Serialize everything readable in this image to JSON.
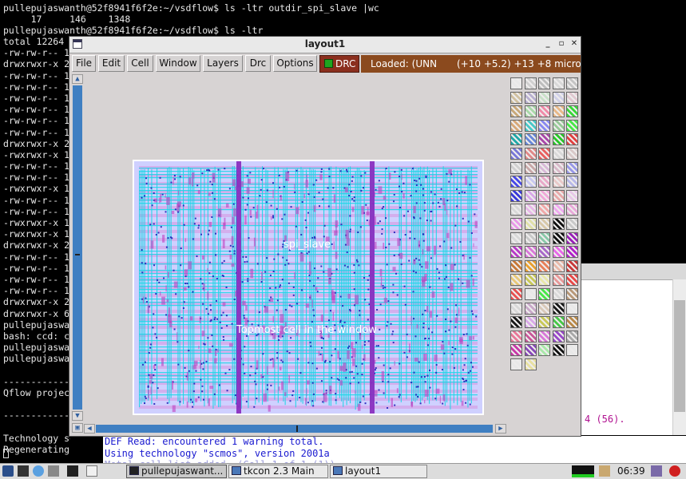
{
  "terminal": {
    "top_lines": [
      "pullepujaswanth@52f8941f6f2e:~/vsdflow$ ls -ltr outdir_spi_slave |wc",
      "     17     146    1348",
      "pullepujaswanth@52f8941f6f2e:~/vsdflow$ ls -ltr"
    ],
    "left_lines": [
      "total 12264",
      "-rw-rw-r-- 1",
      "drwxrwxr-x 2",
      "-rw-rw-r-- 1",
      "-rw-rw-r-- 1",
      "-rw-rw-r-- 1",
      "-rw-rw-r-- 1",
      "-rw-rw-r-- 1",
      "-rw-rw-r-- 1",
      "drwxrwxr-x 2",
      "-rwxrwxr-x 1",
      "-rw-rw-r-- 1",
      "-rw-rw-r-- 1",
      "-rwxrwxr-x 1",
      "-rw-rw-r-- 1",
      "-rw-rw-r-- 1",
      "-rwxrwxr-x 1",
      "-rwxrwxr-x 1",
      "drwxrwxr-x 2",
      "-rw-rw-r-- 1",
      "-rw-rw-r-- 1",
      "-rw-rw-r-- 1",
      "-rw-rw-r-- 1",
      "drwxrwxr-x 2",
      "drwxrwxr-x 6",
      "pullepujaswan",
      "bash: ccd: co",
      "pullepujaswan",
      "pullepujaswan",
      "",
      "------------",
      "Qflow project",
      "",
      "------------",
      "",
      "Technology se",
      "Regenerating files"
    ]
  },
  "tkcon": {
    "lines": [
      "DEF Read: encountered 1 warning total.",
      "Using technology \"scmos\", version 2001a",
      "Metal cell list added. (Cell 1 of 1 (1))"
    ]
  },
  "background_window": {
    "count_text": "4 (56)."
  },
  "magic": {
    "title": "layout1",
    "window_buttons": {
      "minimize": "_",
      "maximize": "▫",
      "close": "✕"
    },
    "menu": [
      "File",
      "Edit",
      "Cell",
      "Window",
      "Layers",
      "Drc",
      "Options"
    ],
    "drc_label": "DRC",
    "status_loaded": "Loaded: (UNN",
    "status_coords": "(+10 +5.2) +13 +8 microns",
    "cell_name": "spi_slave",
    "cell_caption": "Topmost cell in the window",
    "colors": {
      "chip_bg": "#cfd0ff",
      "metal1": "#19d6e6",
      "metal2": "#d888d8",
      "via": "#2020b8",
      "strap": "#8a2fc0",
      "accent": "#3f7fc2"
    }
  },
  "taskbar": {
    "tasks": [
      {
        "label": "pullepujaswant...",
        "active": true
      },
      {
        "label": "tkcon 2.3 Main",
        "active": false
      },
      {
        "label": "layout1",
        "active": false
      }
    ],
    "clock": "06:39"
  }
}
